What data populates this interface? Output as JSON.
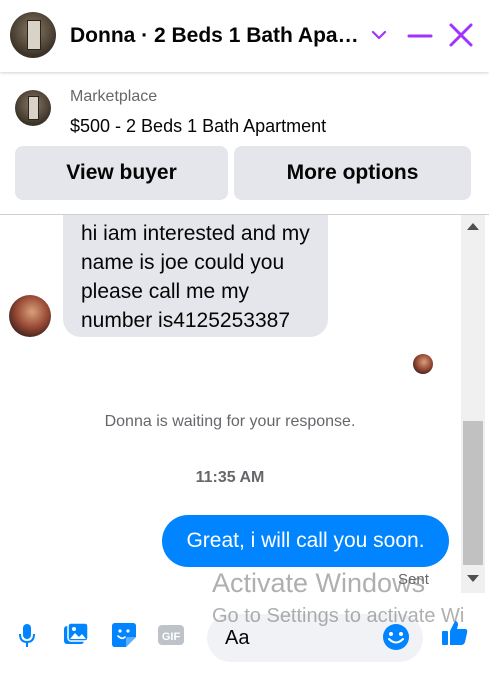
{
  "header": {
    "title": "Donna · 2 Beds 1 Bath Apa…",
    "icons": [
      "chevron-down-icon",
      "minimize-icon",
      "close-icon"
    ],
    "accent_color": "#a033ff"
  },
  "listing": {
    "source": "Marketplace",
    "title": "$500 - 2 Beds 1 Bath Apartment",
    "buttons": {
      "view_buyer": "View buyer",
      "more_options": "More options"
    }
  },
  "messages": {
    "incoming_text": "hi iam interested and my name is joe could you please call me my number is4125253387",
    "status": "Donna is waiting for your response.",
    "timestamp": "11:35 AM",
    "outgoing_text": "Great, i will call you soon.",
    "delivery": "Sent",
    "outgoing_color": "#0084ff"
  },
  "composer": {
    "placeholder": "Aa",
    "icons": [
      "microphone-icon",
      "photo-icon",
      "sticker-icon",
      "gif-icon",
      "emoji-icon",
      "thumbs-up-icon"
    ],
    "gif_label": "GIF",
    "icon_color": "#0084ff"
  },
  "watermark": {
    "line1": "Activate Windows",
    "line2": "Go to Settings to activate Wi"
  }
}
